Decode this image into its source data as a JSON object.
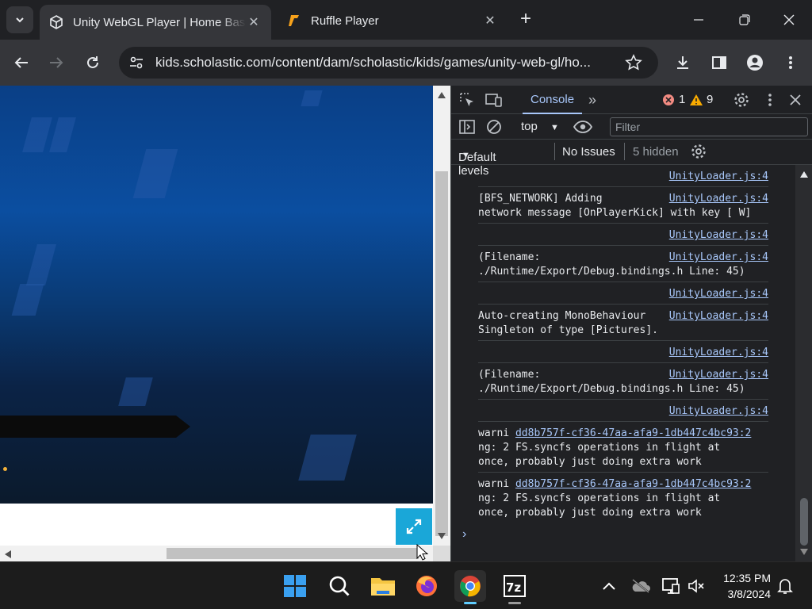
{
  "browser": {
    "tabs": [
      {
        "title": "Unity WebGL Player | Home Bas",
        "active": true,
        "icon": "unity-logo-icon"
      },
      {
        "title": "Ruffle Player",
        "active": false,
        "icon": "ruffle-logo-icon"
      }
    ],
    "url": "kids.scholastic.com/content/dam/scholastic/kids/games/unity-web-gl/ho..."
  },
  "devtools": {
    "panel_tab": "Console",
    "errors": "1",
    "warnings": "9",
    "context": "top",
    "filter_placeholder": "Filter",
    "levels": "Default levels",
    "issues": "No Issues",
    "hidden": "5 hidden",
    "entries": [
      {
        "msg": "",
        "src": "UnityLoader.js:4"
      },
      {
        "msg": "[BFS_NETWORK] Adding\nnetwork message [OnPlayerKick] with key [ W]",
        "src": "UnityLoader.js:4"
      },
      {
        "msg": "",
        "src": "UnityLoader.js:4"
      },
      {
        "msg": "(Filename:\n./Runtime/Export/Debug.bindings.h Line: 45)",
        "src": "UnityLoader.js:4"
      },
      {
        "msg": "",
        "src": "UnityLoader.js:4"
      },
      {
        "msg": "Auto-creating MonoBehaviour\nSingleton of type [Pictures].",
        "src": "UnityLoader.js:4"
      },
      {
        "msg": "",
        "src": "UnityLoader.js:4"
      },
      {
        "msg": "(Filename:\n./Runtime/Export/Debug.bindings.h Line: 45)",
        "src": "UnityLoader.js:4"
      },
      {
        "msg": "",
        "src": "UnityLoader.js:4"
      }
    ],
    "warnings_list": [
      {
        "prefix": "warni",
        "link": "dd8b757f-cf36-47aa-afa9-1db447c4bc93:2",
        "rest": "ng: 2 FS.syncfs operations in flight at\nonce, probably just doing extra work"
      },
      {
        "prefix": "warni",
        "link": "dd8b757f-cf36-47aa-afa9-1db447c4bc93:2",
        "rest": "ng: 2 FS.syncfs operations in flight at\nonce, probably just doing extra work"
      }
    ],
    "prompt": "›"
  },
  "taskbar": {
    "time": "12:35 PM",
    "date": "3/8/2024"
  },
  "colors": {
    "accent": "#a8c7fa",
    "error": "#f28b82",
    "warning": "#fdd663",
    "fullscreen_button": "#1aa7d8"
  }
}
